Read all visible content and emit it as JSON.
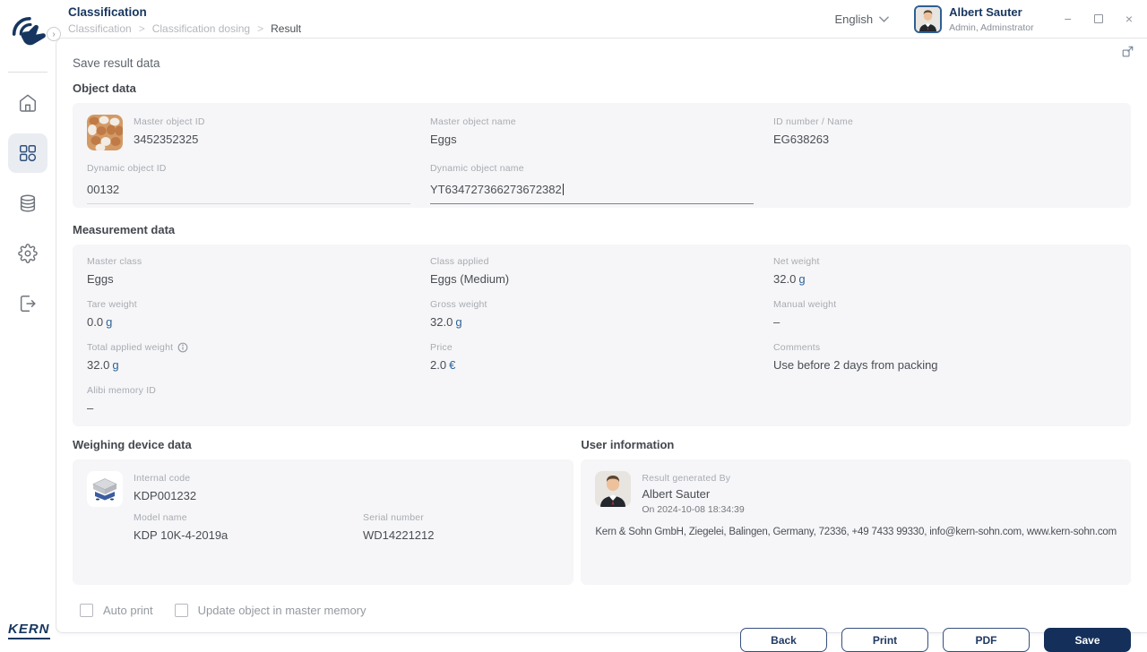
{
  "header": {
    "title": "Classification",
    "breadcrumb": {
      "items": [
        "Classification",
        "Classification dosing",
        "Result"
      ],
      "separator": ">"
    },
    "language": {
      "label": "English"
    },
    "user": {
      "name": "Albert Sauter",
      "role": "Admin, Adminstrator"
    },
    "window": {
      "minimize": "−",
      "close": "×"
    }
  },
  "sidebar": {
    "brand": "KERN",
    "toggle": "›",
    "items": [
      {
        "name": "home",
        "active": false
      },
      {
        "name": "classification-apps",
        "active": true
      },
      {
        "name": "database",
        "active": false
      },
      {
        "name": "settings",
        "active": false
      },
      {
        "name": "logout",
        "active": false
      }
    ]
  },
  "page": {
    "title": "Save result data",
    "object_data": {
      "heading": "Object data",
      "master_object_id": {
        "label": "Master object ID",
        "value": "3452352325"
      },
      "master_object_name": {
        "label": "Master object name",
        "value": "Eggs"
      },
      "id_number": {
        "label": "ID number / Name",
        "value": "EG638263"
      },
      "dynamic_object_id": {
        "label": "Dynamic object ID",
        "value": "00132"
      },
      "dynamic_object_name": {
        "label": "Dynamic object name",
        "value": "YT634727366273672382"
      }
    },
    "measurement": {
      "heading": "Measurement data",
      "fields": [
        {
          "label": "Master class",
          "value": "Eggs"
        },
        {
          "label": "Class applied",
          "value": "Eggs (Medium)"
        },
        {
          "label": "Net weight",
          "value": "32.0",
          "unit": "g"
        },
        {
          "label": "Tare weight",
          "value": "0.0",
          "unit": "g"
        },
        {
          "label": "Gross weight",
          "value": "32.0",
          "unit": "g"
        },
        {
          "label": "Manual weight",
          "value": "–"
        },
        {
          "label": "Total applied weight",
          "value": "32.0",
          "unit": "g"
        },
        {
          "label": "Price",
          "value": "2.0",
          "unit": "€"
        },
        {
          "label": "Comments",
          "value": "Use before 2 days from packing"
        },
        {
          "label": "Alibi memory ID",
          "value": "–"
        }
      ]
    },
    "device": {
      "heading": "Weighing device data",
      "internal_code": {
        "label": "Internal code",
        "value": "KDP001232"
      },
      "model_name": {
        "label": "Model name",
        "value": "KDP 10K-4-2019a"
      },
      "serial_number": {
        "label": "Serial number",
        "value": "WD14221212"
      }
    },
    "user_info": {
      "heading": "User information",
      "generated_by_label": "Result generated By",
      "name": "Albert Sauter",
      "timestamp": "On 2024-10-08 18:34:39",
      "company": "Kern & Sohn GmbH, Ziegelei, Balingen, Germany, 72336, +49 7433 99330, info@kern-sohn.com, www.kern-sohn.com"
    },
    "options": [
      {
        "label": "Auto print",
        "checked": false
      },
      {
        "label": "Update object in master memory",
        "checked": false
      }
    ],
    "actions": {
      "back": "Back",
      "print": "Print",
      "pdf": "PDF",
      "save": "Save"
    }
  },
  "colors": {
    "navy": "#17365f",
    "unit_blue": "#2d6296",
    "card_bg": "#f6f6f8",
    "active_nav_bg": "#e9ecf1"
  }
}
